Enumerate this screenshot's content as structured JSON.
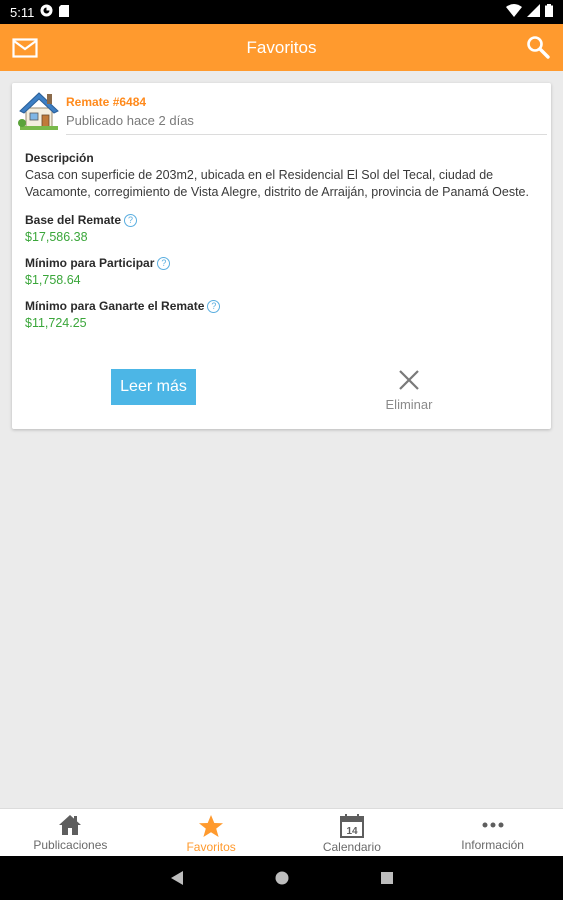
{
  "status_bar": {
    "time": "5:11"
  },
  "app_bar": {
    "title": "Favoritos"
  },
  "card": {
    "title": "Remate #6484",
    "subtitle": "Publicado hace 2 días",
    "description_label": "Descripción",
    "description": "Casa con superficie de 203m2, ubicada en el Residencial El Sol del Tecal, ciudad de Vacamonte, corregimiento de Vista Alegre, distrito de Arraiján, provincia de Panamá Oeste.",
    "fields": [
      {
        "label": "Base del Remate",
        "value": "$17,586.38"
      },
      {
        "label": "Mínimo para Participar",
        "value": "$1,758.64"
      },
      {
        "label": "Mínimo para Ganarte el Remate",
        "value": "$11,724.25"
      }
    ],
    "read_more_label": "Leer más",
    "delete_label": "Eliminar"
  },
  "bottom_nav": {
    "items": [
      {
        "label": "Publicaciones",
        "icon": "home-icon"
      },
      {
        "label": "Favoritos",
        "icon": "star-icon",
        "active": true
      },
      {
        "label": "Calendario",
        "icon": "calendar-icon",
        "day": "14"
      },
      {
        "label": "Información",
        "icon": "more-icon"
      }
    ]
  },
  "colors": {
    "accent": "#ff9a2e",
    "button": "#4cb6e6",
    "money": "#3aa63a"
  }
}
